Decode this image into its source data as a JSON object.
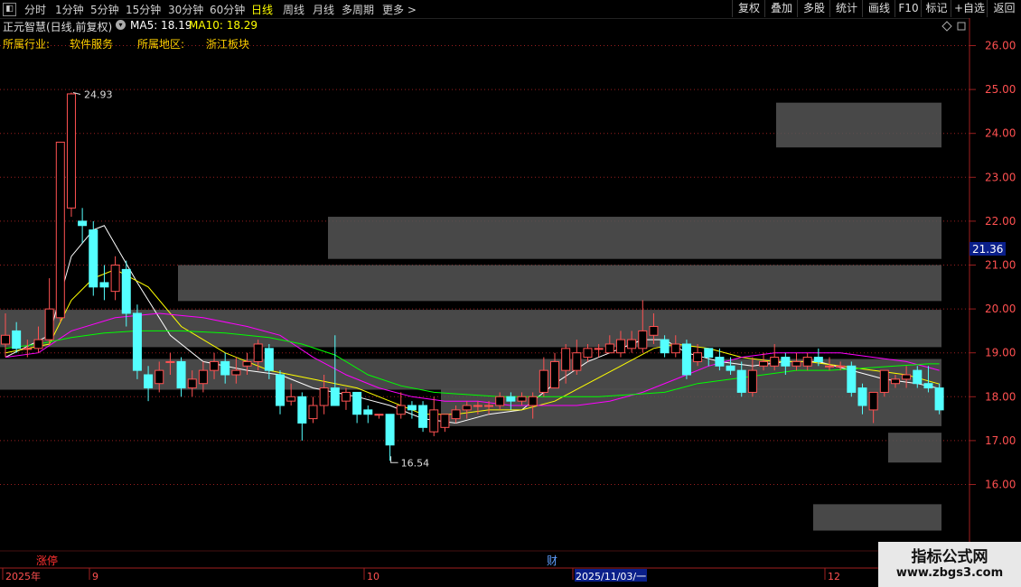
{
  "toolbar": {
    "icon": "collapse-icon",
    "periods": [
      "分时",
      "1分钟",
      "5分钟",
      "15分钟",
      "30分钟",
      "60分钟",
      "日线",
      "周线",
      "月线",
      "多周期",
      "更多 >"
    ],
    "active_period": "日线",
    "right_buttons": [
      "复权",
      "叠加",
      "多股",
      "统计",
      "画线",
      "F10",
      "标记",
      "+自选",
      "返回"
    ]
  },
  "stock": {
    "title": "正元智慧(日线,前复权)",
    "ma5_label": "MA5: 18.19",
    "ma10_label": "MA10: 18.29",
    "industry_label": "所属行业:",
    "industry_value": "软件服务",
    "region_label": "所属地区:",
    "region_value": "浙江板块"
  },
  "colors": {
    "background": "#000000",
    "up": "#ff5252",
    "down": "#54ffff",
    "ma5": "#ffffff",
    "ma10": "#ffff00",
    "ma20": "#ff00ff",
    "ma60": "#00ff00",
    "grid": "#9a1f1f",
    "box": "#555555",
    "price_tag_bg": "#0a1f8a"
  },
  "chart_data": {
    "type": "candlestick",
    "y_range": [
      15.2,
      26.4
    ],
    "y_ticks": [
      "26.00",
      "25.00",
      "24.00",
      "23.00",
      "22.00",
      "21.00",
      "20.00",
      "19.00",
      "18.00",
      "17.00",
      "16.00"
    ],
    "current_price": "21.36",
    "high_label": "24.93",
    "low_label": "16.54",
    "x_labels": [
      "2025年",
      "9",
      "10",
      "2025/11/03/一",
      "12"
    ],
    "markers": [
      "涨停",
      "财"
    ],
    "candles": [
      [
        19.2,
        19.4,
        19.9,
        18.9
      ],
      [
        19.5,
        19.1,
        19.7,
        19.0
      ],
      [
        19.1,
        19.1,
        19.3,
        18.9
      ],
      [
        19.1,
        19.3,
        19.6,
        19.0
      ],
      [
        19.3,
        20.0,
        20.7,
        19.2
      ],
      [
        19.8,
        23.8,
        23.8,
        19.7
      ],
      [
        22.3,
        24.9,
        24.93,
        22.1
      ],
      [
        22.0,
        21.9,
        22.3,
        21.5
      ],
      [
        21.8,
        20.5,
        22.0,
        20.3
      ],
      [
        20.6,
        20.5,
        21.0,
        20.2
      ],
      [
        20.4,
        21.0,
        21.2,
        20.2
      ],
      [
        20.9,
        19.9,
        21.1,
        19.6
      ],
      [
        19.9,
        18.6,
        20.1,
        18.4
      ],
      [
        18.5,
        18.2,
        18.7,
        17.9
      ],
      [
        18.3,
        18.6,
        18.8,
        18.1
      ],
      [
        18.8,
        18.8,
        19.0,
        18.5
      ],
      [
        18.8,
        18.2,
        18.9,
        18.0
      ],
      [
        18.2,
        18.4,
        18.6,
        18.0
      ],
      [
        18.3,
        18.6,
        18.8,
        18.1
      ],
      [
        18.6,
        18.8,
        19.0,
        18.4
      ],
      [
        18.8,
        18.5,
        19.0,
        18.3
      ],
      [
        18.5,
        18.6,
        18.9,
        18.3
      ],
      [
        18.7,
        18.8,
        19.0,
        18.5
      ],
      [
        18.8,
        19.2,
        19.3,
        18.6
      ],
      [
        19.1,
        18.6,
        19.2,
        18.4
      ],
      [
        18.5,
        17.8,
        18.6,
        17.6
      ],
      [
        17.9,
        18.0,
        18.3,
        17.8
      ],
      [
        18.0,
        17.4,
        18.1,
        17.0
      ],
      [
        17.5,
        17.8,
        18.0,
        17.4
      ],
      [
        17.8,
        18.2,
        18.5,
        17.6
      ],
      [
        18.2,
        17.8,
        19.4,
        17.8
      ],
      [
        17.9,
        18.1,
        18.2,
        17.7
      ],
      [
        18.1,
        17.6,
        18.1,
        17.4
      ],
      [
        17.7,
        17.6,
        17.8,
        17.4
      ],
      [
        17.6,
        17.6,
        17.6,
        17.5
      ],
      [
        17.6,
        16.9,
        17.6,
        16.54
      ],
      [
        17.6,
        17.8,
        18.1,
        17.5
      ],
      [
        17.8,
        17.7,
        17.9,
        17.5
      ],
      [
        17.8,
        17.3,
        17.9,
        17.2
      ],
      [
        17.2,
        17.7,
        18.0,
        17.1
      ],
      [
        17.3,
        17.6,
        17.6,
        17.2
      ],
      [
        17.5,
        17.7,
        17.8,
        17.4
      ],
      [
        17.7,
        17.8,
        17.9,
        17.5
      ],
      [
        17.8,
        17.8,
        17.9,
        17.6
      ],
      [
        17.8,
        17.8,
        17.9,
        17.6
      ],
      [
        17.8,
        18.0,
        18.1,
        17.7
      ],
      [
        18.0,
        17.9,
        18.1,
        17.7
      ],
      [
        17.9,
        18.0,
        18.1,
        17.8
      ],
      [
        17.8,
        18.0,
        18.1,
        17.5
      ],
      [
        18.1,
        18.6,
        18.9,
        18.0
      ],
      [
        18.2,
        18.8,
        19.0,
        18.2
      ],
      [
        18.6,
        19.1,
        19.2,
        18.3
      ],
      [
        18.6,
        19.0,
        19.3,
        18.5
      ],
      [
        18.9,
        19.1,
        19.2,
        18.8
      ],
      [
        19.1,
        19.1,
        19.2,
        18.9
      ],
      [
        19.0,
        19.2,
        19.4,
        19.0
      ],
      [
        19.0,
        19.3,
        19.5,
        18.9
      ],
      [
        19.1,
        19.3,
        19.5,
        19.0
      ],
      [
        19.1,
        19.5,
        20.2,
        19.0
      ],
      [
        19.4,
        19.6,
        19.9,
        19.2
      ],
      [
        19.3,
        19.0,
        19.4,
        18.9
      ],
      [
        19.0,
        19.2,
        19.4,
        18.9
      ],
      [
        19.2,
        18.5,
        19.3,
        18.4
      ],
      [
        18.8,
        19.0,
        19.2,
        18.7
      ],
      [
        19.1,
        18.9,
        19.1,
        18.7
      ],
      [
        18.9,
        18.7,
        19.1,
        18.6
      ],
      [
        18.7,
        18.6,
        18.9,
        18.5
      ],
      [
        18.6,
        18.1,
        18.8,
        18.0
      ],
      [
        18.1,
        18.6,
        18.9,
        18.0
      ],
      [
        18.7,
        18.8,
        19.0,
        18.6
      ],
      [
        18.7,
        18.9,
        19.2,
        18.6
      ],
      [
        18.9,
        18.7,
        19.0,
        18.5
      ],
      [
        18.7,
        18.8,
        19.0,
        18.6
      ],
      [
        18.7,
        18.9,
        19.0,
        18.6
      ],
      [
        18.9,
        18.8,
        19.1,
        18.7
      ],
      [
        18.7,
        18.7,
        18.9,
        18.6
      ],
      [
        18.7,
        18.7,
        18.8,
        18.6
      ],
      [
        18.7,
        18.1,
        18.8,
        18.0
      ],
      [
        18.2,
        17.8,
        18.3,
        17.6
      ],
      [
        17.7,
        18.1,
        18.1,
        17.4
      ],
      [
        18.1,
        18.6,
        18.6,
        18.0
      ],
      [
        18.3,
        18.4,
        18.5,
        18.2
      ],
      [
        18.4,
        18.5,
        18.7,
        18.2
      ],
      [
        18.6,
        18.3,
        18.7,
        18.2
      ],
      [
        18.3,
        18.2,
        18.7,
        18.1
      ],
      [
        18.2,
        17.7,
        18.3,
        17.6
      ]
    ],
    "boxes": [
      [
        18.18,
        17.33
      ],
      [
        18.86,
        18.16
      ],
      [
        19.98,
        19.13
      ],
      [
        21.0,
        20.18
      ],
      [
        22.1,
        21.14
      ],
      [
        24.7,
        23.68
      ],
      [
        17.18,
        16.5
      ],
      [
        15.55,
        14.95
      ]
    ],
    "ma": {
      "ma5": [
        [
          0,
          18.9
        ],
        [
          4,
          19.4
        ],
        [
          6,
          21.2
        ],
        [
          8,
          21.8
        ],
        [
          9,
          21.9
        ],
        [
          12,
          20.6
        ],
        [
          15,
          19.4
        ],
        [
          18,
          18.8
        ],
        [
          22,
          18.6
        ],
        [
          25,
          18.5
        ],
        [
          28,
          18.2
        ],
        [
          32,
          18.0
        ],
        [
          35,
          17.8
        ],
        [
          38,
          17.5
        ],
        [
          41,
          17.4
        ],
        [
          44,
          17.6
        ],
        [
          47,
          17.7
        ],
        [
          50,
          18.3
        ],
        [
          53,
          18.8
        ],
        [
          56,
          19.1
        ],
        [
          58,
          19.3
        ],
        [
          60,
          19.3
        ],
        [
          62,
          19.0
        ],
        [
          65,
          18.8
        ],
        [
          68,
          18.7
        ],
        [
          71,
          18.8
        ],
        [
          74,
          18.8
        ],
        [
          77,
          18.6
        ],
        [
          80,
          18.4
        ],
        [
          83,
          18.3
        ],
        [
          85,
          18.19
        ]
      ],
      "ma10": [
        [
          0,
          19.0
        ],
        [
          4,
          19.2
        ],
        [
          6,
          20.2
        ],
        [
          8,
          20.7
        ],
        [
          10,
          20.9
        ],
        [
          13,
          20.5
        ],
        [
          16,
          19.6
        ],
        [
          20,
          19.0
        ],
        [
          24,
          18.6
        ],
        [
          28,
          18.4
        ],
        [
          32,
          18.2
        ],
        [
          35,
          17.9
        ],
        [
          38,
          17.6
        ],
        [
          41,
          17.6
        ],
        [
          44,
          17.7
        ],
        [
          47,
          17.7
        ],
        [
          50,
          17.9
        ],
        [
          53,
          18.3
        ],
        [
          56,
          18.7
        ],
        [
          59,
          19.1
        ],
        [
          61,
          19.2
        ],
        [
          64,
          19.1
        ],
        [
          67,
          18.9
        ],
        [
          70,
          18.8
        ],
        [
          73,
          18.8
        ],
        [
          76,
          18.7
        ],
        [
          79,
          18.6
        ],
        [
          82,
          18.5
        ],
        [
          85,
          18.29
        ]
      ],
      "ma20": [
        [
          0,
          18.9
        ],
        [
          3,
          19.0
        ],
        [
          6,
          19.5
        ],
        [
          10,
          19.8
        ],
        [
          14,
          19.9
        ],
        [
          18,
          19.8
        ],
        [
          22,
          19.6
        ],
        [
          25,
          19.4
        ],
        [
          28,
          18.9
        ],
        [
          31,
          18.5
        ],
        [
          34,
          18.2
        ],
        [
          37,
          18.0
        ],
        [
          40,
          17.9
        ],
        [
          43,
          17.9
        ],
        [
          46,
          17.8
        ],
        [
          49,
          17.8
        ],
        [
          52,
          17.8
        ],
        [
          55,
          17.9
        ],
        [
          58,
          18.1
        ],
        [
          61,
          18.4
        ],
        [
          64,
          18.7
        ],
        [
          67,
          18.9
        ],
        [
          70,
          19.0
        ],
        [
          73,
          19.0
        ],
        [
          76,
          19.0
        ],
        [
          79,
          18.9
        ],
        [
          82,
          18.8
        ],
        [
          85,
          18.6
        ]
      ],
      "ma60": [
        [
          0,
          19.1
        ],
        [
          3,
          19.2
        ],
        [
          6,
          19.35
        ],
        [
          9,
          19.45
        ],
        [
          12,
          19.5
        ],
        [
          16,
          19.5
        ],
        [
          20,
          19.45
        ],
        [
          24,
          19.35
        ],
        [
          27,
          19.2
        ],
        [
          30,
          18.95
        ],
        [
          33,
          18.5
        ],
        [
          36,
          18.25
        ],
        [
          39,
          18.1
        ],
        [
          42,
          18.05
        ],
        [
          45,
          18.0
        ],
        [
          48,
          18.0
        ],
        [
          51,
          18.0
        ],
        [
          54,
          18.0
        ],
        [
          57,
          18.05
        ],
        [
          60,
          18.1
        ],
        [
          63,
          18.3
        ],
        [
          66,
          18.4
        ],
        [
          69,
          18.5
        ],
        [
          72,
          18.6
        ],
        [
          75,
          18.6
        ],
        [
          78,
          18.65
        ],
        [
          81,
          18.7
        ],
        [
          84,
          18.75
        ],
        [
          85,
          18.75
        ]
      ]
    }
  },
  "watermark": {
    "line1": "指标公式网",
    "line2": "www.zbgs3.com"
  }
}
